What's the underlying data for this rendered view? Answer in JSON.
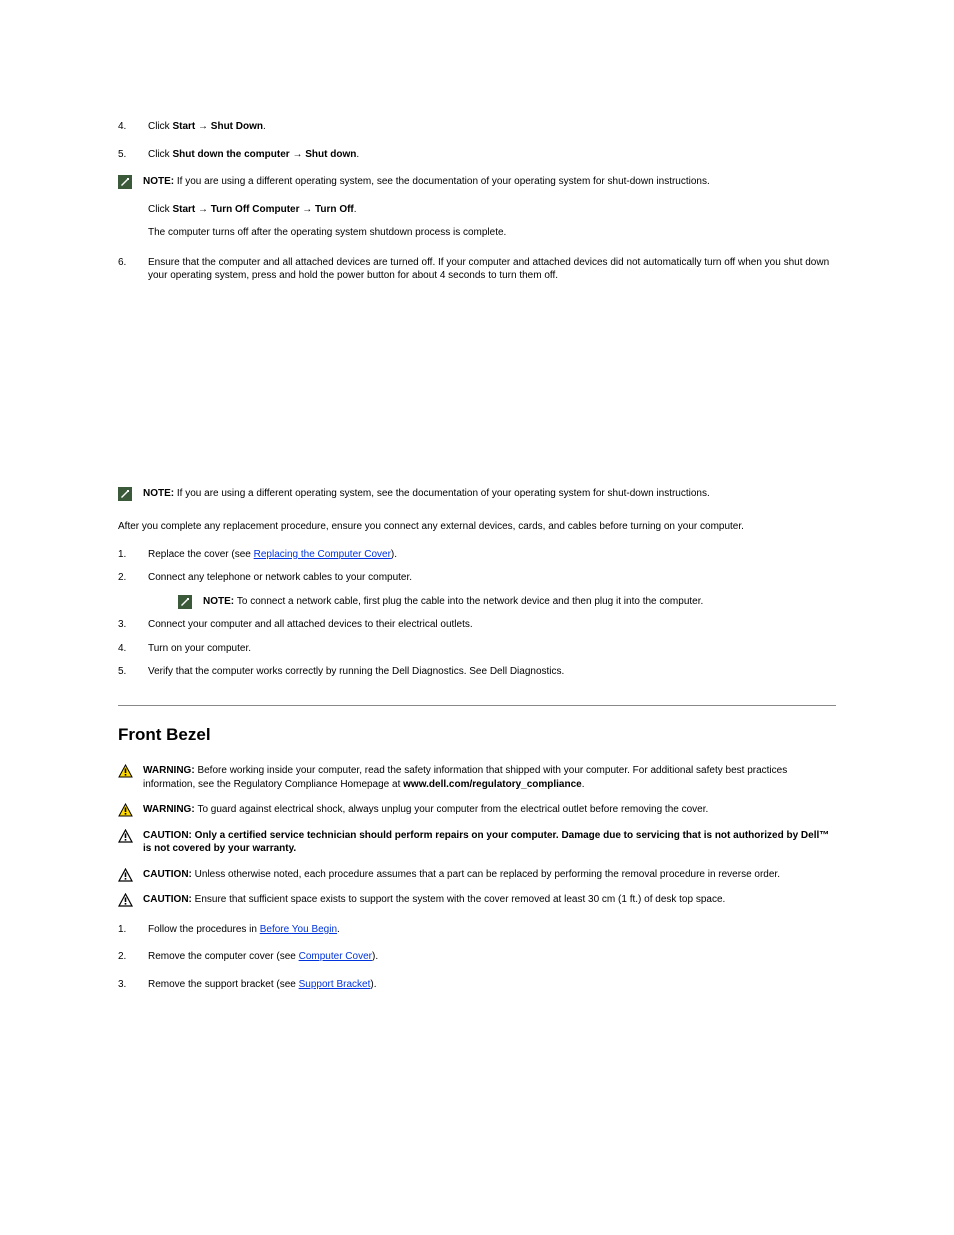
{
  "steps_top": {
    "s4": {
      "num": "4.",
      "text_pre": "Click ",
      "bold1": "Start ",
      "arrow1": "→",
      "bold2": " Shut Down",
      "text_post": "."
    },
    "s5": {
      "num": "5.",
      "line1_pre": "Click ",
      "line1_bold": "Shut down the computer",
      "line1_mid": " ",
      "line1_arrow": "→",
      "line1_bold2": " Shut down",
      "line1_post": ".",
      "note_label": "NOTE: ",
      "note_text": "If you are using a different operating system, see the documentation of your operating system for shut-down instructions.",
      "line2_pre": "Click ",
      "line2_bold": "Start ",
      "line2_arrow": "→",
      "line2_bold2": " Turn Off Computer",
      "line2_arrow2": " →",
      "line2_bold3": " Turn Off",
      "line2_post": ".",
      "line3": "The computer turns off after the operating system shutdown process is complete."
    },
    "s6": {
      "num": "6.",
      "text": "Ensure that the computer and all attached devices are turned off. If your computer and attached devices did not automatically turn off when you shut down your operating system, press and hold the power button for about 4 seconds to turn them off."
    }
  },
  "after_note": {
    "label": "NOTE: ",
    "text": "If you are using a different operating system, see the documentation of your operating system for shut-down instructions."
  },
  "after_working": {
    "p1": "After you complete any replacement procedure, ensure you connect any external devices, cards, and cables before turning on your computer.",
    "s1": {
      "num": "1.",
      "text_pre": "Replace the cover (see ",
      "link": "Replacing the Computer Cover",
      "text_post": ")."
    },
    "s2": {
      "num": "2.",
      "text": "Connect any telephone or network cables to your computer.",
      "note_label": "NOTE: ",
      "note_text": "To connect a network cable, first plug the cable into the network device and then plug it into the computer."
    },
    "s3": {
      "num": "3.",
      "text": "Connect your computer and all attached devices to their electrical outlets."
    },
    "s4": {
      "num": "4.",
      "text": "Turn on your computer."
    },
    "s5": {
      "num": "5.",
      "text": "Verify that the computer works correctly by running the Dell Diagnostics. See Dell Diagnostics."
    }
  },
  "heading": "Front Bezel",
  "alerts": {
    "w1": {
      "label": "WARNING: ",
      "text": "Before working inside your computer, read the safety information that shipped with your computer. For additional safety best practices information, see the Regulatory Compliance Homepage at ",
      "link": "www.dell.com/regulatory_compliance",
      "post": "."
    },
    "w2": {
      "label": "WARNING: ",
      "text": "To guard against electrical shock, always unplug your computer from the electrical outlet before removing the cover."
    },
    "c1": {
      "label": "CAUTION:  ",
      "bold": "Only a certified service technician should perform repairs on your computer. Damage due to servicing that is not authorized by Dell™ is not covered by your warranty."
    },
    "c2": {
      "label": "CAUTION: ",
      "text": "Unless otherwise noted, each procedure assumes that a part can be replaced by performing the removal procedure in reverse order."
    },
    "c3": {
      "label": "CAUTION: ",
      "text": "Ensure that sufficient space exists to support the system with the cover removed at least 30 cm (1 ft.) of desk top space."
    }
  },
  "bezel_steps": {
    "s1": {
      "num": "1.",
      "text_pre": "Follow the procedures in ",
      "link": "Before You Begin",
      "text_post": "."
    },
    "s2": {
      "num": "2.",
      "text_pre": "Remove the computer cover (see ",
      "link": "Computer Cover",
      "text_post": ")."
    },
    "s3": {
      "num": "3.",
      "text_pre": "Remove the support bracket (see ",
      "link": "Support Bracket",
      "text_post": ")."
    }
  }
}
